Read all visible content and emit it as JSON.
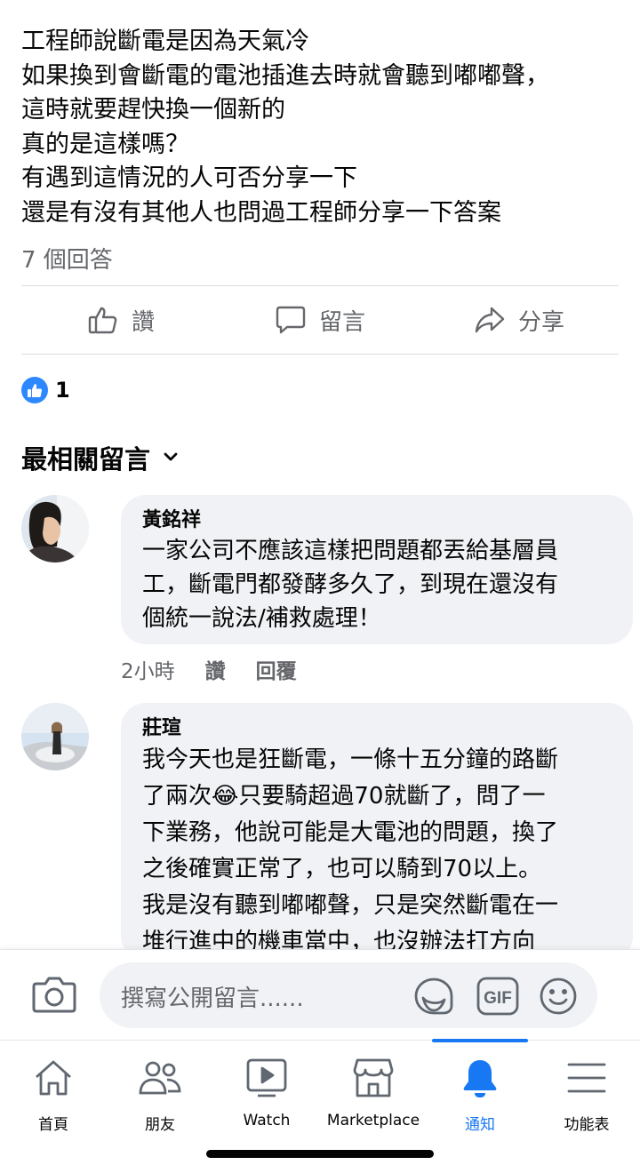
{
  "post": {
    "lines": [
      "工程師說斷電是因為天氣冷",
      "如果換到會斷電的電池插進去時就會聽到嘟嘟聲，",
      "這時就要趕快換一個新的",
      "真的是這樣嗎？",
      "有遇到這情況的人可否分享一下",
      "還是有沒有其他人也問過工程師分享一下答案"
    ],
    "answer_count": "7 個回答"
  },
  "actions": {
    "like": "讚",
    "comment": "留言",
    "share": "分享"
  },
  "reactions": {
    "count": "1"
  },
  "sort_label": "最相關留言",
  "comments": [
    {
      "author": "黃銘祥",
      "lines": [
        "一家公司不應該這樣把問題都丟給基層員",
        "工，斷電門都發酵多久了，到現在還沒有",
        "個統一說法/補救處理！"
      ],
      "time": "2小時",
      "like": "讚",
      "reply": "回覆"
    },
    {
      "author": "莊瑄",
      "lines": [
        "我今天也是狂斷電，一條十五分鐘的路斷",
        "了兩次😂只要騎超過70就斷了，問了一",
        "下業務，他說可能是大電池的問題，換了",
        "之後確實正常了，也可以騎到70以上。",
        "我是沒有聽到嘟嘟聲，只是突然斷電在一",
        "堆行進中的機車當中，也沒辦法打方向"
      ]
    }
  ],
  "composer": {
    "placeholder": "撰寫公開留言......",
    "gif": "GIF"
  },
  "tabs": [
    "首頁",
    "朋友",
    "Watch",
    "Marketplace",
    "通知",
    "功能表"
  ],
  "colors": {
    "accent": "#1877f2",
    "secondary_text": "#65676b",
    "bubble": "#f0f2f5"
  }
}
